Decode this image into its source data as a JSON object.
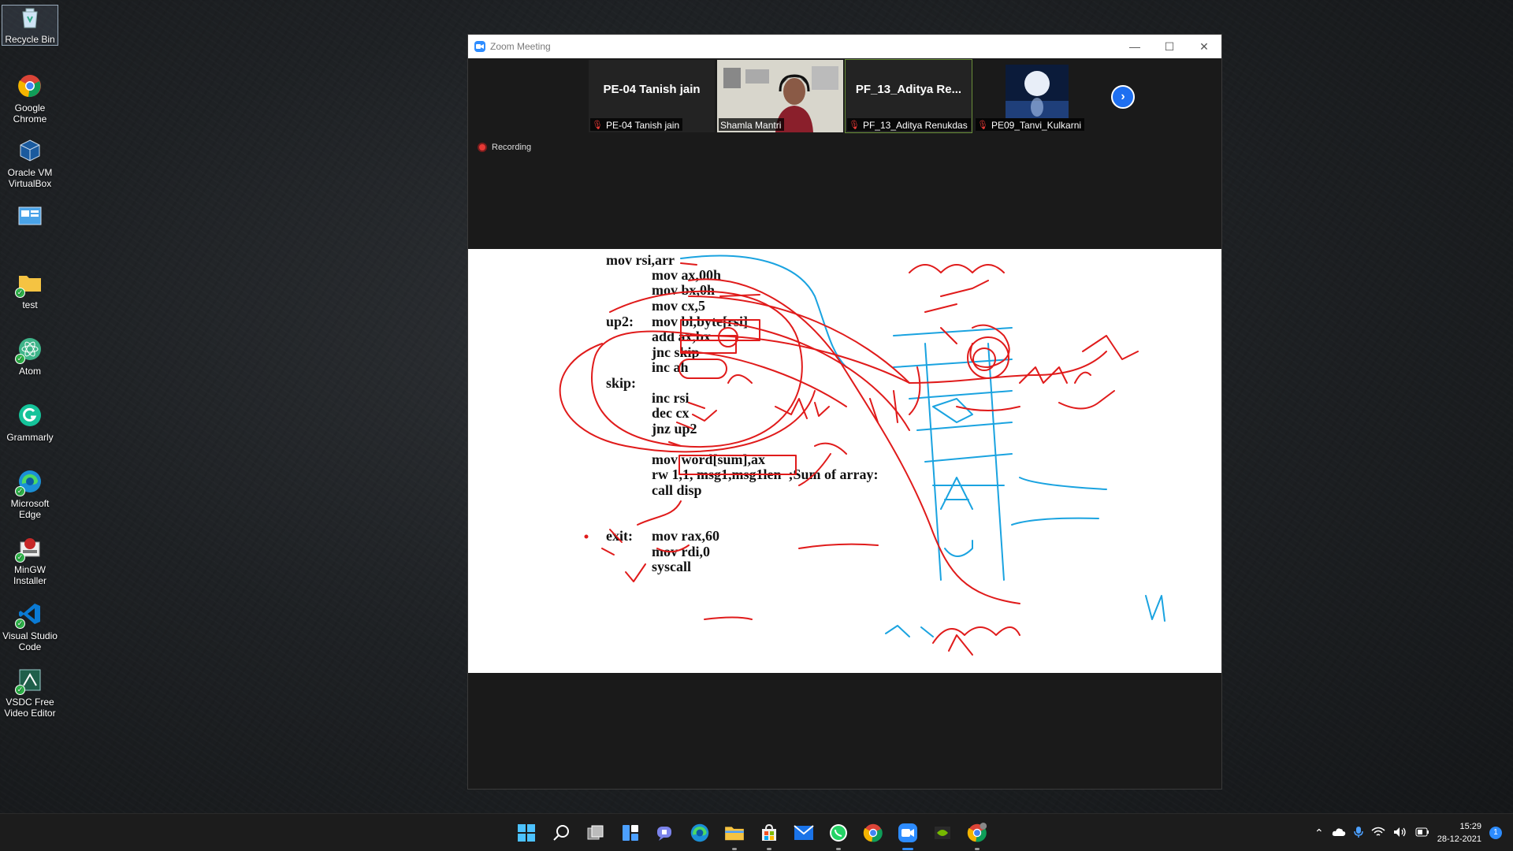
{
  "desktop": {
    "icons": [
      {
        "name": "recycle-bin",
        "label": "Recycle Bin",
        "icon": "recycle-bin-icon"
      },
      {
        "name": "google-chrome",
        "label": "Google Chrome",
        "icon": "chrome-icon"
      },
      {
        "name": "oracle-vm-virtualbox",
        "label": "Oracle VM VirtualBox",
        "icon": "virtualbox-icon"
      },
      {
        "name": "unnamed-app",
        "label": "",
        "icon": "app-window-icon"
      },
      {
        "name": "test-folder",
        "label": "test",
        "icon": "folder-icon"
      },
      {
        "name": "atom",
        "label": "Atom",
        "icon": "atom-icon"
      },
      {
        "name": "grammarly",
        "label": "Grammarly",
        "icon": "grammarly-icon"
      },
      {
        "name": "microsoft-edge",
        "label": "Microsoft Edge",
        "icon": "edge-icon"
      },
      {
        "name": "mingw-installer",
        "label": "MinGW Installer",
        "icon": "mingw-icon"
      },
      {
        "name": "visual-studio-code",
        "label": "Visual Studio Code",
        "icon": "vscode-icon"
      },
      {
        "name": "vsdc-free-video-editor",
        "label": "VSDC Free Video Editor",
        "icon": "vsdc-icon"
      }
    ]
  },
  "zoom": {
    "title": "Zoom Meeting",
    "recording_label": "Recording",
    "participants": [
      {
        "big_name": "PE-04 Tanish jain",
        "name": "PE-04 Tanish jain",
        "muted": true,
        "video": false
      },
      {
        "big_name": "",
        "name": "Shamla Mantri",
        "muted": false,
        "video": true
      },
      {
        "big_name": "PF_13_Aditya  Re...",
        "name": "PF_13_Aditya Renukdas",
        "muted": true,
        "video": false,
        "active": true
      },
      {
        "big_name": "",
        "name": "PE09_Tanvi_Kulkarni",
        "muted": true,
        "video": true
      }
    ],
    "shared_screen": {
      "code_lines": [
        "mov rsi,arr",
        "mov ax,00h",
        "mov bx,0h",
        "mov cx,5",
        "up2:",
        "mov bl,byte[rsi]",
        "add ax,bx",
        "jnc skip",
        "inc ah",
        "skip:",
        "inc rsi",
        "dec cx",
        "jnz up2",
        "mov word[sum],ax",
        "rw 1,1, msg1,msg1len  ;Sum of array:",
        "call disp",
        "exit:",
        "mov rax,60",
        "mov rdi,0",
        "syscall"
      ]
    }
  },
  "taskbar": {
    "apps": [
      "windows-start-icon",
      "search-icon",
      "task-view-icon",
      "widgets-icon",
      "teams-chat-icon",
      "edge-icon",
      "file-explorer-icon",
      "store-icon",
      "mail-icon",
      "whatsapp-icon",
      "chrome-icon",
      "zoom-icon",
      "nvidia-icon",
      "chrome-profile-icon"
    ],
    "time": "15:29",
    "date": "28-12-2021",
    "notification_count": "1"
  }
}
